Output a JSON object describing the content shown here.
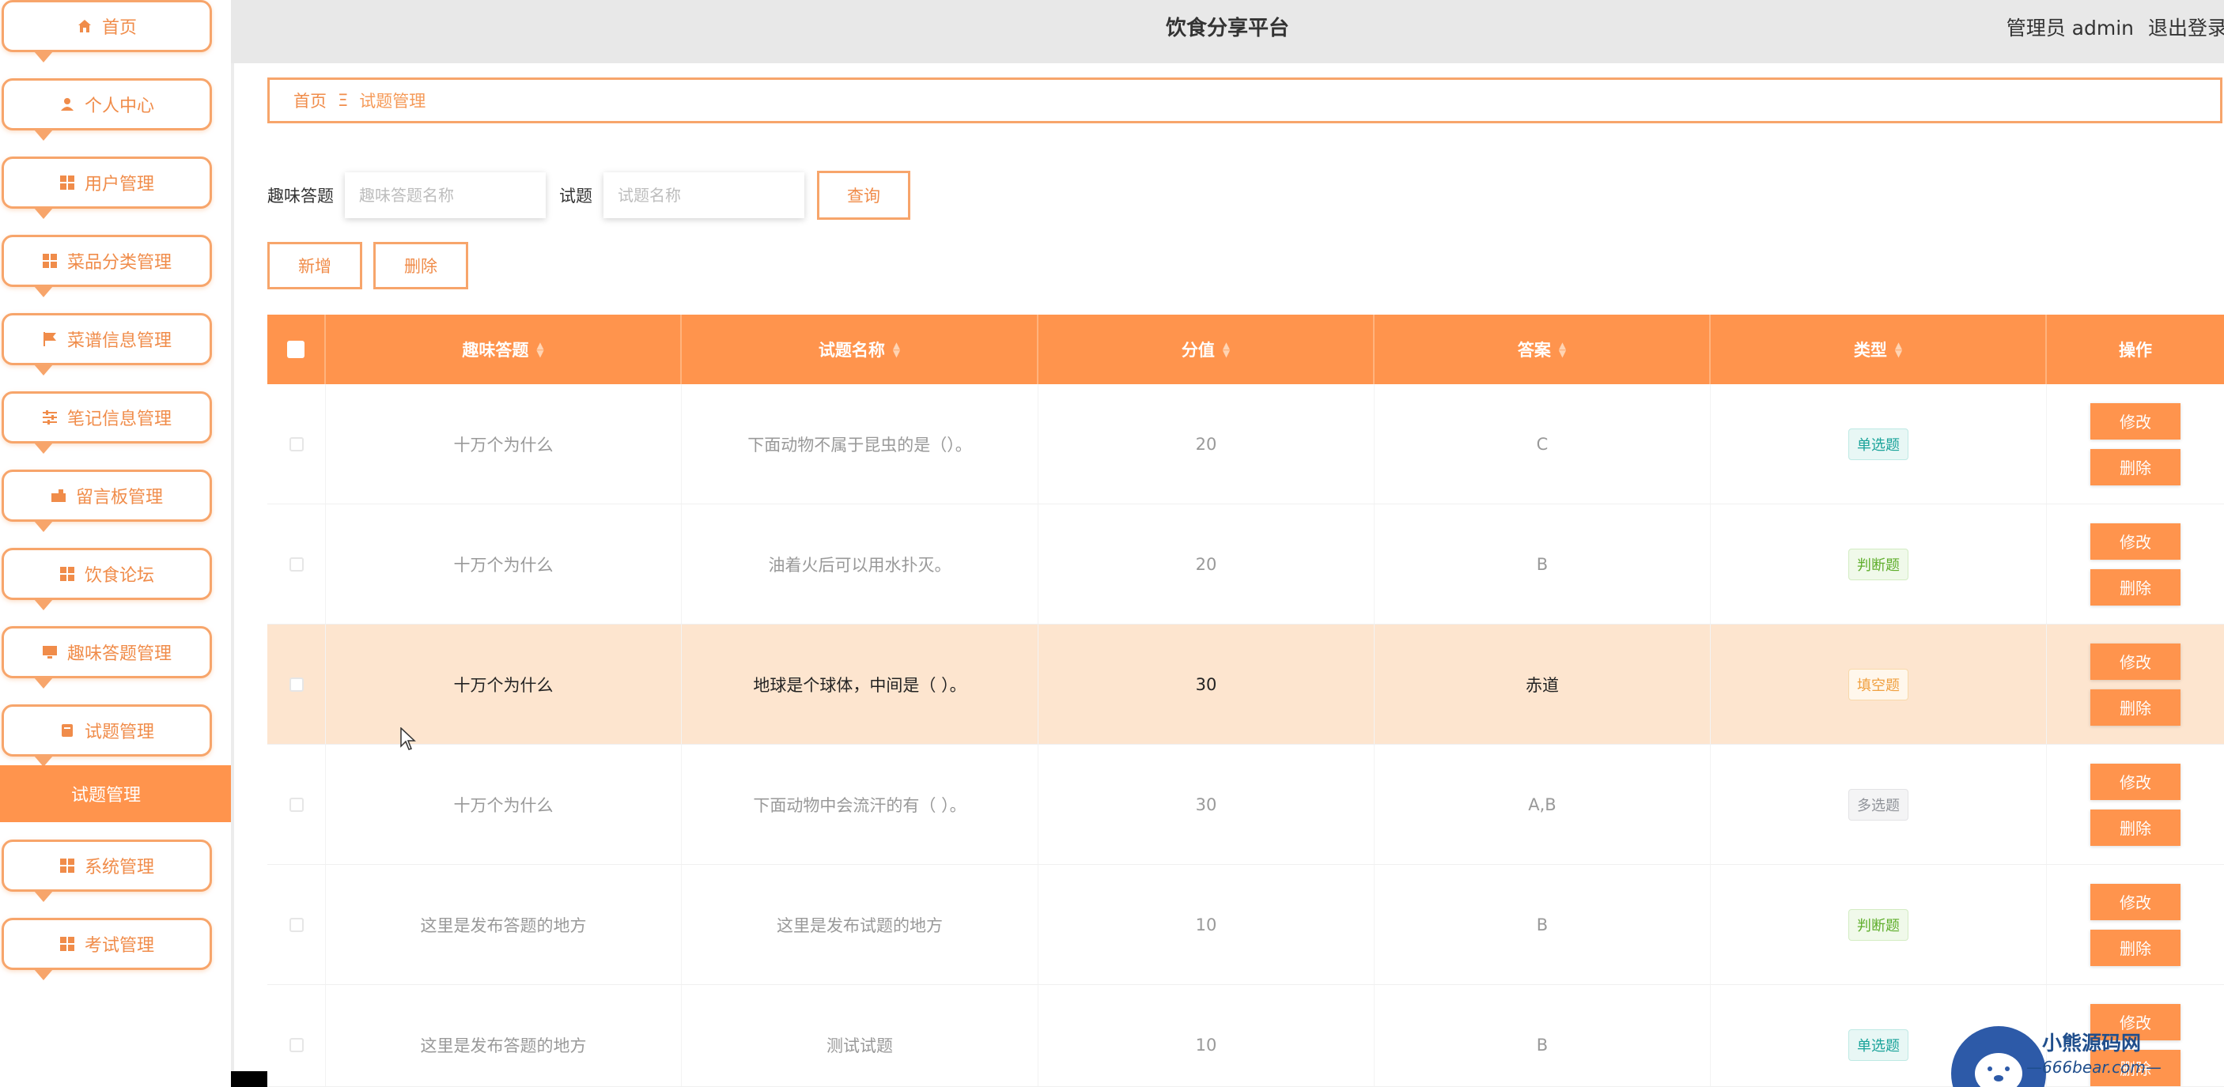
{
  "app": {
    "title": "饮食分享平台",
    "user_role": "管理员 admin",
    "logout": "退出登录"
  },
  "colors": {
    "accent": "#ff944d",
    "accent_border": "#f7a56b",
    "highlight_row": "#fde5cf"
  },
  "sidebar": {
    "items": [
      {
        "label": "首页",
        "icon": "home-icon"
      },
      {
        "label": "个人中心",
        "icon": "user-icon"
      },
      {
        "label": "用户管理",
        "icon": "grid-icon"
      },
      {
        "label": "菜品分类管理",
        "icon": "grid-icon"
      },
      {
        "label": "菜谱信息管理",
        "icon": "flag-icon"
      },
      {
        "label": "笔记信息管理",
        "icon": "sliders-icon"
      },
      {
        "label": "留言板管理",
        "icon": "message-icon"
      },
      {
        "label": "饮食论坛",
        "icon": "grid-icon"
      },
      {
        "label": "趣味答题管理",
        "icon": "monitor-icon"
      },
      {
        "label": "试题管理",
        "icon": "document-icon"
      },
      {
        "label": "系统管理",
        "icon": "grid-icon"
      },
      {
        "label": "考试管理",
        "icon": "grid-icon"
      }
    ],
    "active_sub": "试题管理"
  },
  "breadcrumb": {
    "home": "首页",
    "separator": "Ξ",
    "current": "试题管理"
  },
  "search": {
    "label1": "趣味答题",
    "placeholder1": "趣味答题名称",
    "label2": "试题",
    "placeholder2": "试题名称",
    "query_button": "查询"
  },
  "actions": {
    "add": "新增",
    "delete": "删除"
  },
  "table": {
    "headers": [
      "趣味答题",
      "试题名称",
      "分值",
      "答案",
      "类型",
      "操作"
    ],
    "edit_label": "修改",
    "delete_label": "删除",
    "rows": [
      {
        "quiz": "十万个为什么",
        "question": "下面动物不属于昆虫的是（）。",
        "score": "20",
        "answer": "C",
        "type": "单选题"
      },
      {
        "quiz": "十万个为什么",
        "question": "油着火后可以用水扑灭。",
        "score": "20",
        "answer": "B",
        "type": "判断题"
      },
      {
        "quiz": "十万个为什么",
        "question": "地球是个球体，中间是（ ）。",
        "score": "30",
        "answer": "赤道",
        "type": "填空题"
      },
      {
        "quiz": "十万个为什么",
        "question": "下面动物中会流汗的有（ ）。",
        "score": "30",
        "answer": "A,B",
        "type": "多选题"
      },
      {
        "quiz": "这里是发布答题的地方",
        "question": "这里是发布试题的地方",
        "score": "10",
        "answer": "B",
        "type": "判断题"
      },
      {
        "quiz": "这里是发布答题的地方",
        "question": "测试试题",
        "score": "10",
        "answer": "B",
        "type": "单选题"
      }
    ]
  },
  "watermark": {
    "line1": "小熊源码网",
    "line2": "—666bear.com—"
  }
}
